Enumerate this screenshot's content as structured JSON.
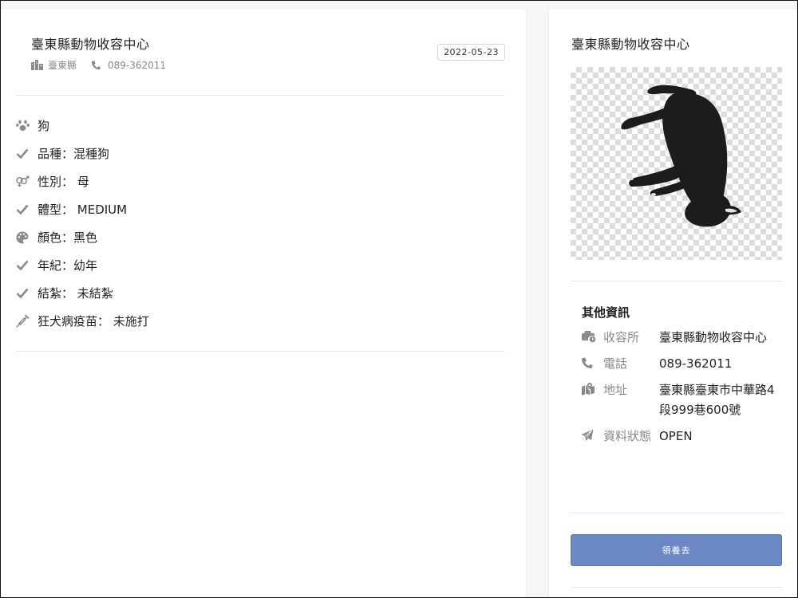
{
  "header": {
    "org_title": "臺東縣動物收容中心",
    "county": "臺東縣",
    "phone": "089-362011",
    "date": "2022-05-23"
  },
  "attributes": [
    {
      "icon": "paw-icon",
      "text": "狗"
    },
    {
      "icon": "check-icon",
      "text": "品種：混種狗"
    },
    {
      "icon": "gender-icon",
      "text": "性別： 母"
    },
    {
      "icon": "check-icon",
      "text": "體型： MEDIUM"
    },
    {
      "icon": "palette-icon",
      "text": "顏色：黑色"
    },
    {
      "icon": "check-icon",
      "text": "年紀：幼年"
    },
    {
      "icon": "check-icon",
      "text": "結紮： 未結紮"
    },
    {
      "icon": "syringe-icon",
      "text": "狂犬病疫苗： 未施打"
    }
  ],
  "sidebar": {
    "title": "臺東縣動物收容中心",
    "other_info_title": "其他資訊",
    "info": [
      {
        "icon": "briefcase-clock-icon",
        "label": "收容所",
        "value": "臺東縣動物收容中心"
      },
      {
        "icon": "phone-icon",
        "label": "電話",
        "value": "089-362011"
      },
      {
        "icon": "map-marker-icon",
        "label": "地址",
        "value": "臺東縣臺東市中華路4段999巷600號"
      },
      {
        "icon": "paper-plane-icon",
        "label": "資料狀態",
        "value": "OPEN"
      }
    ],
    "adopt_label": "領養去"
  },
  "colors": {
    "button": "#6b87c6",
    "icon_gray": "#8a8a8a"
  }
}
